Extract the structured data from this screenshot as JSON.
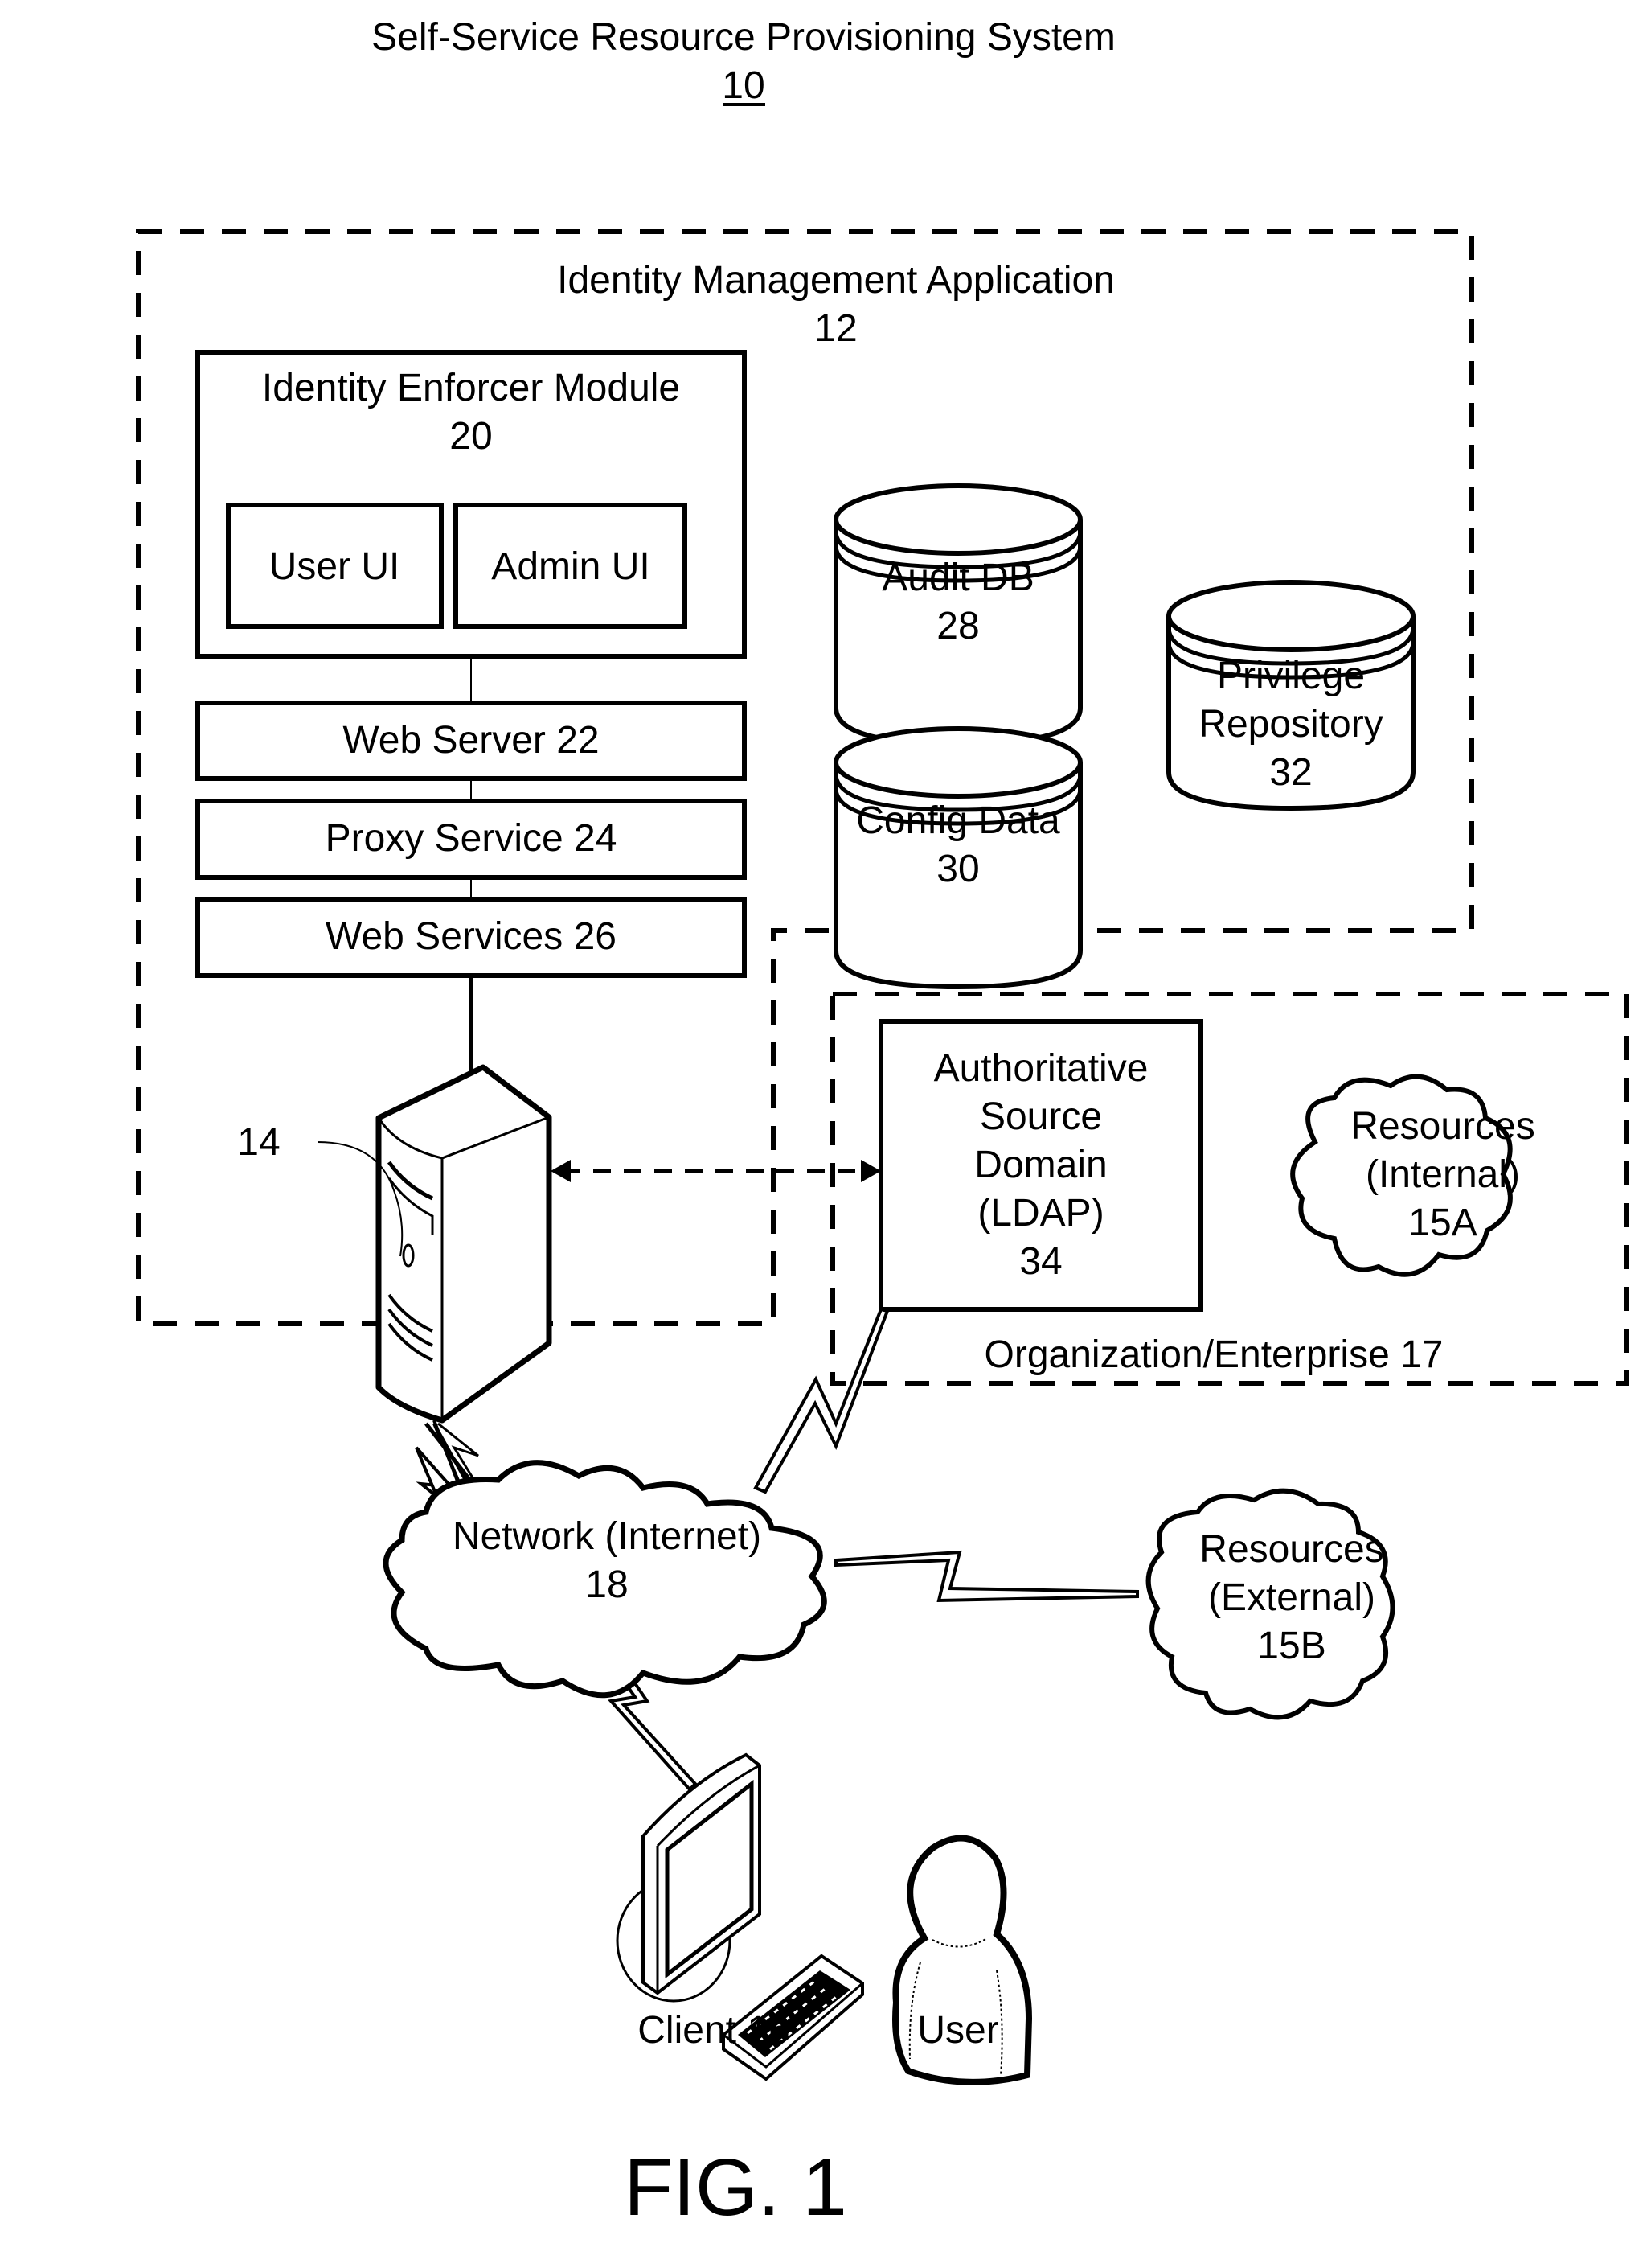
{
  "header": {
    "title": "Self-Service Resource Provisioning System",
    "ref": "10"
  },
  "identity_management_app": {
    "label": "Identity Management Application",
    "ref": "12"
  },
  "identity_enforcer": {
    "label": "Identity Enforcer Module",
    "ref": "20",
    "user_ui": "User UI",
    "admin_ui": "Admin UI"
  },
  "stack": {
    "web_server": "Web Server 22",
    "proxy_service": "Proxy Service 24",
    "web_services": "Web Services 26"
  },
  "databases": {
    "audit": {
      "label": "Audit DB",
      "ref": "28"
    },
    "config": {
      "label": "Config Data",
      "ref": "30"
    },
    "privilege": {
      "label1": "Privilege",
      "label2": "Repository",
      "ref": "32"
    }
  },
  "server": {
    "ref": "14"
  },
  "organization": {
    "label": "Organization/Enterprise 17"
  },
  "ldap": {
    "line1": "Authoritative",
    "line2": "Source",
    "line3": "Domain",
    "line4": "(LDAP)",
    "ref": "34"
  },
  "resources_internal": {
    "line1": "Resources",
    "line2": "(Internal)",
    "ref": "15A"
  },
  "network": {
    "line1": "Network (Internet)",
    "ref": "18"
  },
  "resources_external": {
    "line1": "Resources",
    "line2": "(External)",
    "ref": "15B"
  },
  "client": {
    "label": "Client 16"
  },
  "user": {
    "label": "User"
  },
  "figure": {
    "label": "FIG. 1"
  }
}
